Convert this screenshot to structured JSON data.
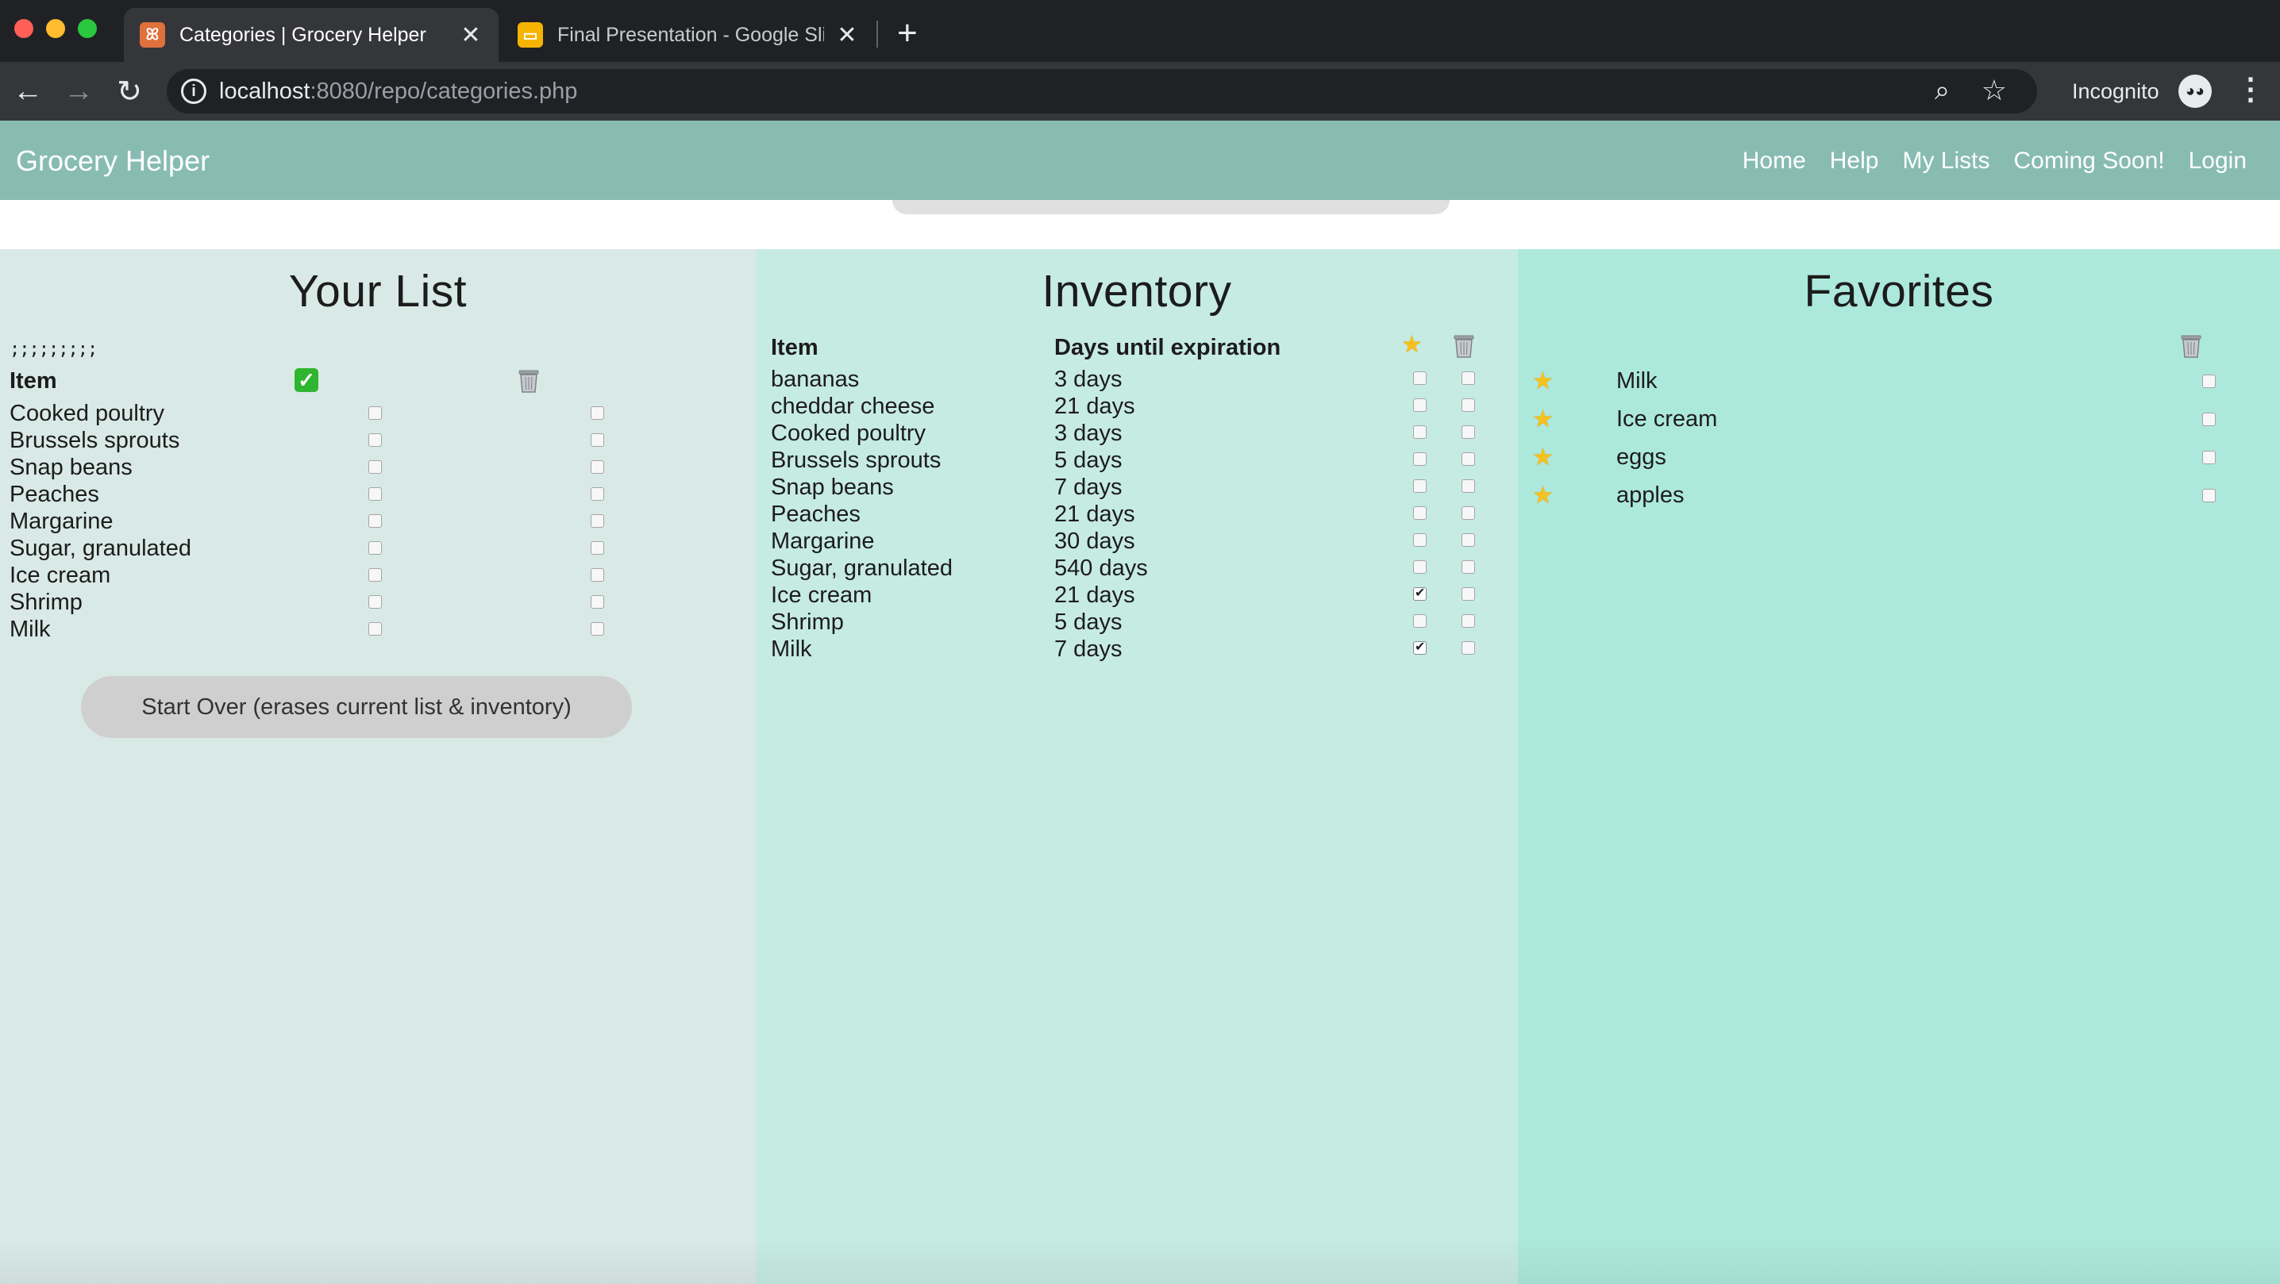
{
  "browser": {
    "tabs": [
      {
        "title": "Categories | Grocery Helper",
        "favicon": "grocery-favicon",
        "active": true
      },
      {
        "title": "Final Presentation - Google Sli",
        "favicon": "slides-favicon",
        "active": false
      }
    ],
    "url_host": "localhost",
    "url_rest": ":8080/repo/categories.php",
    "incognito_label": "Incognito"
  },
  "app": {
    "brand": "Grocery Helper",
    "nav": [
      "Home",
      "Help",
      "My Lists",
      "Coming Soon!",
      "Login"
    ],
    "colors": {
      "header": "#88bcb3",
      "list_bg": "#d9e9e6",
      "inventory_bg": "#c6ebe2",
      "favorites_bg": "#ade8dc"
    }
  },
  "your_list": {
    "title": "Your List",
    "handle": ";;;;;;;;;",
    "header_item": "Item",
    "items": [
      {
        "name": "Cooked poultry",
        "bought": false,
        "remove": false
      },
      {
        "name": "Brussels sprouts",
        "bought": false,
        "remove": false
      },
      {
        "name": "Snap beans",
        "bought": false,
        "remove": false
      },
      {
        "name": "Peaches",
        "bought": false,
        "remove": false
      },
      {
        "name": "Margarine",
        "bought": false,
        "remove": false
      },
      {
        "name": "Sugar, granulated",
        "bought": false,
        "remove": false
      },
      {
        "name": "Ice cream",
        "bought": false,
        "remove": false
      },
      {
        "name": "Shrimp",
        "bought": false,
        "remove": false
      },
      {
        "name": "Milk",
        "bought": false,
        "remove": false
      }
    ],
    "start_over_label": "Start Over (erases current list & inventory)"
  },
  "inventory": {
    "title": "Inventory",
    "header_item": "Item",
    "header_days": "Days until expiration",
    "items": [
      {
        "name": "bananas",
        "days": "3 days",
        "favorite": false,
        "remove": false
      },
      {
        "name": "cheddar cheese",
        "days": "21 days",
        "favorite": false,
        "remove": false
      },
      {
        "name": "Cooked poultry",
        "days": "3 days",
        "favorite": false,
        "remove": false
      },
      {
        "name": "Brussels sprouts",
        "days": "5 days",
        "favorite": false,
        "remove": false
      },
      {
        "name": "Snap beans",
        "days": "7 days",
        "favorite": false,
        "remove": false
      },
      {
        "name": "Peaches",
        "days": "21 days",
        "favorite": false,
        "remove": false
      },
      {
        "name": "Margarine",
        "days": "30 days",
        "favorite": false,
        "remove": false
      },
      {
        "name": "Sugar, granulated",
        "days": "540 days",
        "favorite": false,
        "remove": false
      },
      {
        "name": "Ice cream",
        "days": "21 days",
        "favorite": true,
        "remove": false
      },
      {
        "name": "Shrimp",
        "days": "5 days",
        "favorite": false,
        "remove": false
      },
      {
        "name": "Milk",
        "days": "7 days",
        "favorite": true,
        "remove": false
      }
    ]
  },
  "favorites": {
    "title": "Favorites",
    "items": [
      {
        "name": "Milk",
        "remove": false
      },
      {
        "name": "Ice cream",
        "remove": false
      },
      {
        "name": "eggs",
        "remove": false
      },
      {
        "name": "apples",
        "remove": false
      }
    ]
  }
}
